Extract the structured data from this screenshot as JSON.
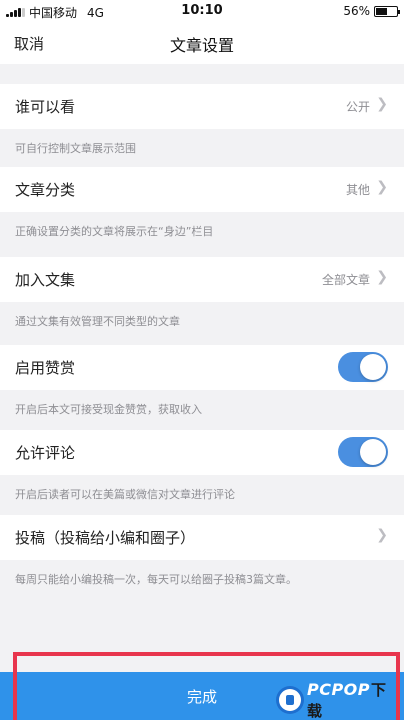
{
  "status_bar": {
    "carrier": "中国移动",
    "network": "4G",
    "time": "10:10",
    "battery": "56%",
    "battery_level": 0.56
  },
  "nav": {
    "cancel": "取消",
    "title": "文章设置"
  },
  "settings": [
    {
      "label": "谁可以看",
      "value": "公开",
      "hint": "可自行控制文章展示范围"
    },
    {
      "label": "文章分类",
      "value": "其他",
      "hint": "正确设置分类的文章将展示在“身边”栏目"
    },
    {
      "label": "加入文集",
      "value": "全部文章",
      "hint": "通过文集有效管理不同类型的文章"
    },
    {
      "label": "启用赞赏",
      "toggle": true,
      "hint": "开启后本文可接受现金赞赏，获取收入"
    },
    {
      "label": "允许评论",
      "toggle": true,
      "hint": "开启后读者可以在美篇或微信对文章进行评论"
    },
    {
      "label": "投稿（投稿给小编和圈子）",
      "hint": "每周只能给小编投稿一次，每天可以给圈子投稿3篇文章。"
    }
  ],
  "footer": {
    "done": "完成"
  },
  "watermark": {
    "text": "PCPOP",
    "suffix": "下载"
  },
  "colors": {
    "accent": "#2f92ea",
    "toggle_on": "#4a8fe0",
    "highlight": "#e8354d"
  }
}
